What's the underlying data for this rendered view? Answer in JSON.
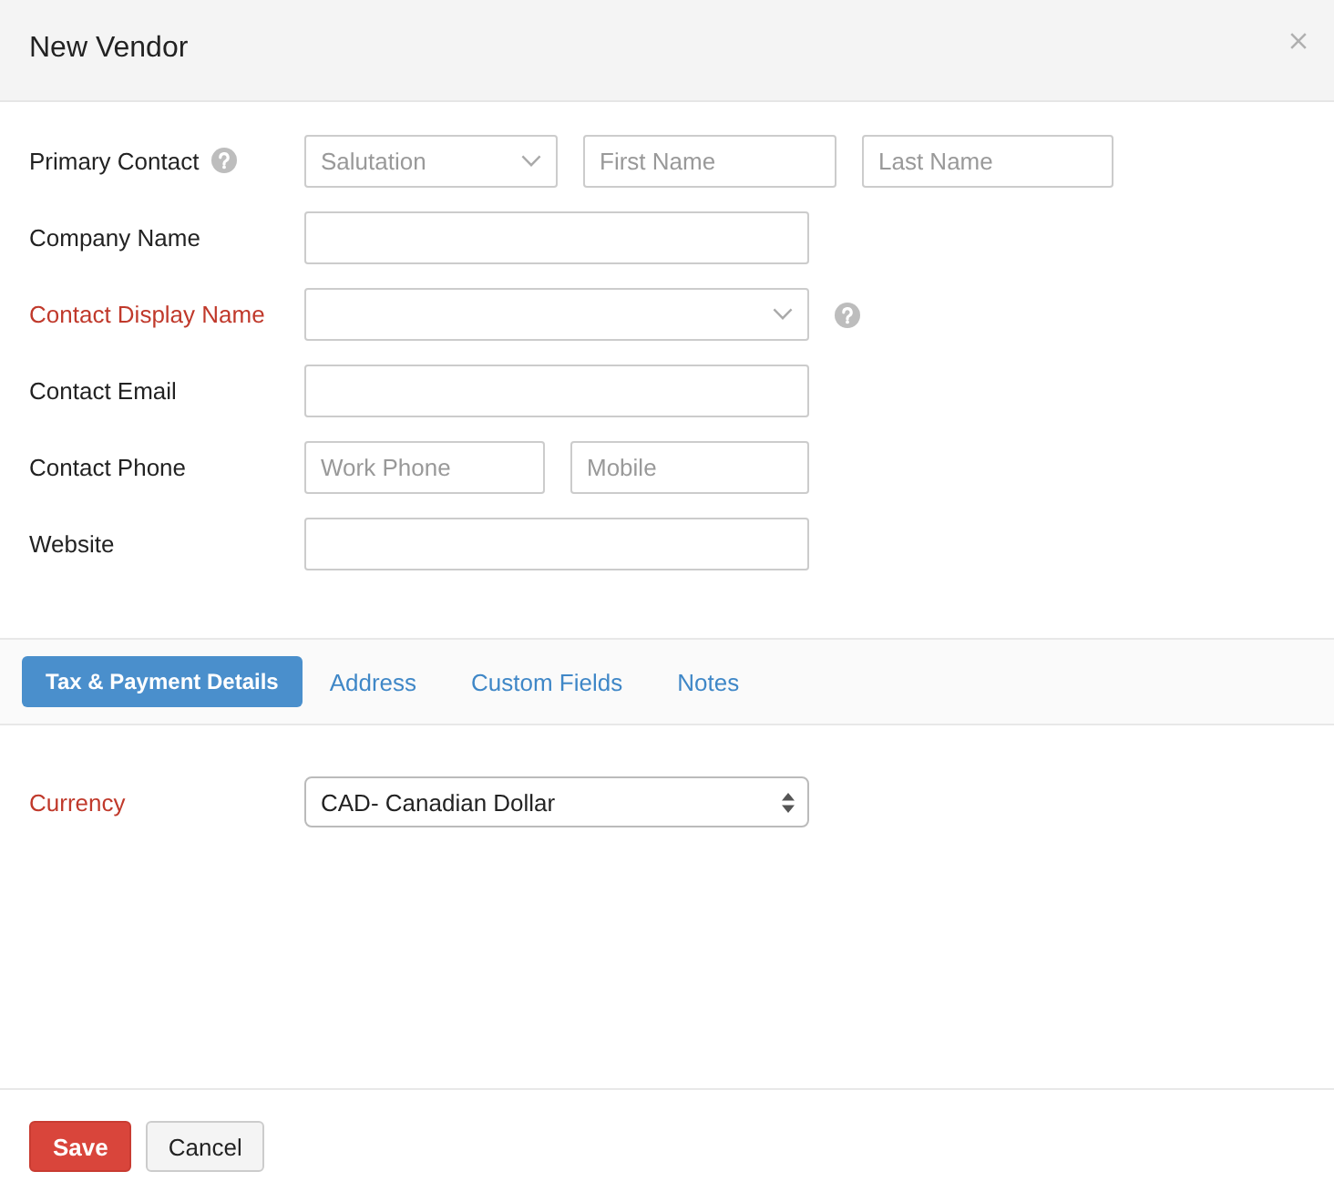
{
  "window": {
    "title": "New Vendor"
  },
  "contact_fields": [
    {
      "label": "Primary Contact",
      "required": false,
      "label_help": true,
      "inputs": [
        {
          "kind": "dropdown",
          "placeholder": "Salutation"
        },
        {
          "kind": "text",
          "placeholder": "First Name"
        },
        {
          "kind": "text",
          "placeholder": "Last Name"
        }
      ]
    },
    {
      "label": "Company Name",
      "required": false,
      "inputs": [
        {
          "kind": "text"
        }
      ]
    },
    {
      "label": "Contact Display Name",
      "required": true,
      "field_help": true,
      "inputs": [
        {
          "kind": "dropdown"
        }
      ]
    },
    {
      "label": "Contact Email",
      "required": false,
      "inputs": [
        {
          "kind": "text"
        }
      ]
    },
    {
      "label": "Contact Phone",
      "required": false,
      "inputs": [
        {
          "kind": "text",
          "placeholder": "Work Phone"
        },
        {
          "kind": "text",
          "placeholder": "Mobile"
        }
      ]
    },
    {
      "label": "Website",
      "required": false,
      "inputs": [
        {
          "kind": "text"
        }
      ]
    }
  ],
  "tabs": [
    {
      "label": "Tax & Payment Details",
      "selected": true
    },
    {
      "label": "Address",
      "selected": false
    },
    {
      "label": "Custom Fields",
      "selected": false
    },
    {
      "label": "Notes",
      "selected": false
    }
  ],
  "tab_panel": {
    "fields": [
      {
        "label": "Currency",
        "required": true,
        "inputs": [
          {
            "kind": "select",
            "value": "CAD- Canadian Dollar"
          }
        ]
      }
    ]
  },
  "buttons": [
    {
      "label": "Save",
      "kind": "primary"
    },
    {
      "label": "Cancel",
      "kind": "secondary"
    }
  ]
}
